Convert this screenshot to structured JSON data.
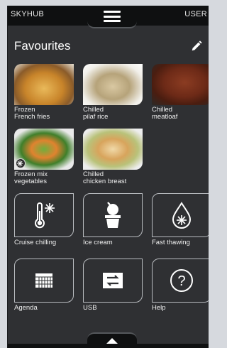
{
  "topbar": {
    "left_label": "SKYHUB",
    "right_label": "USER"
  },
  "favourites": {
    "title": "Favourites",
    "items": [
      {
        "line1": "Frozen",
        "line2": "French fries"
      },
      {
        "line1": "Chilled",
        "line2": "pilaf rice"
      },
      {
        "line1": "Chilled",
        "line2": "meatloaf"
      },
      {
        "line1": "Frozen mix",
        "line2": "vegetables"
      },
      {
        "line1": "Chilled",
        "line2": "chicken breast"
      }
    ]
  },
  "functions": [
    {
      "label": "Cruise chilling",
      "icon": "thermometer-snowflake-icon"
    },
    {
      "label": "Ice cream",
      "icon": "ice-cream-icon"
    },
    {
      "label": "Fast thawing",
      "icon": "drop-snowflake-icon"
    },
    {
      "label": "Agenda",
      "icon": "calendar-icon"
    },
    {
      "label": "USB",
      "icon": "usb-transfer-icon"
    },
    {
      "label": "Help",
      "icon": "help-icon",
      "glyph": "?"
    }
  ]
}
